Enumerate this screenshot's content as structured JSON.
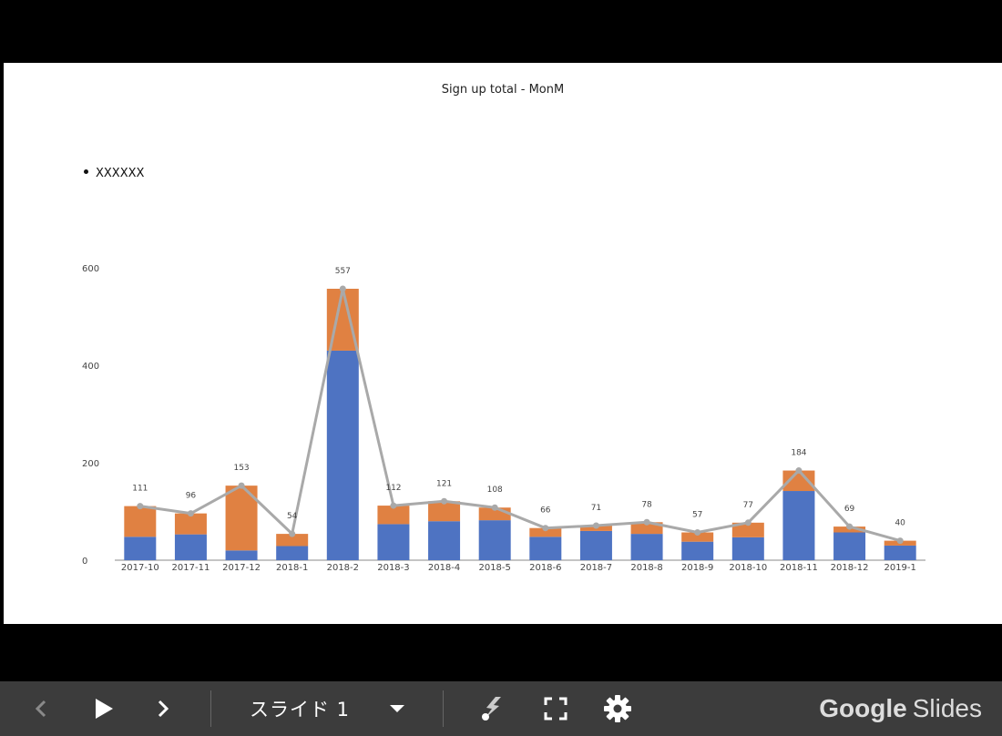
{
  "slide": {
    "title": "Sign up total - MonM",
    "bullet": "XXXXXX"
  },
  "chart_data": {
    "type": "bar",
    "stacked": true,
    "with_line_overlay": true,
    "categories": [
      "2017-10",
      "2017-11",
      "2017-12",
      "2018-1",
      "2018-2",
      "2018-3",
      "2018-4",
      "2018-5",
      "2018-6",
      "2018-7",
      "2018-8",
      "2018-9",
      "2018-10",
      "2018-11",
      "2018-12",
      "2019-1"
    ],
    "series": [
      {
        "values": [
          48,
          53,
          20,
          29,
          430,
          74,
          80,
          82,
          48,
          60,
          54,
          38,
          47,
          142,
          57,
          30
        ],
        "color": "#4e73c2"
      },
      {
        "values": [
          63,
          43,
          133,
          25,
          127,
          38,
          41,
          26,
          18,
          11,
          24,
          19,
          30,
          42,
          12,
          10
        ],
        "color": "#e08142"
      }
    ],
    "line": {
      "values": [
        111,
        96,
        153,
        54,
        557,
        112,
        121,
        108,
        66,
        71,
        78,
        57,
        77,
        184,
        69,
        40
      ],
      "color": "#a9a9a9"
    },
    "data_labels": [
      "111",
      "96",
      "153",
      "54",
      "557",
      "112",
      "121",
      "108",
      "66",
      "71",
      "78",
      "57",
      "77",
      "184",
      "69",
      "40"
    ],
    "yticks": [
      "0",
      "200",
      "400",
      "600"
    ],
    "ylim": [
      0,
      600
    ],
    "legend": "none",
    "grid": false
  },
  "toolbar": {
    "slide_label": "スライド 1",
    "brand_bold": "Google",
    "brand_light": "Slides",
    "icons": [
      "chevron-left-icon",
      "play-icon",
      "chevron-right-icon",
      "dropdown-icon",
      "laser-pointer-icon",
      "fullscreen-icon",
      "gear-icon"
    ]
  }
}
